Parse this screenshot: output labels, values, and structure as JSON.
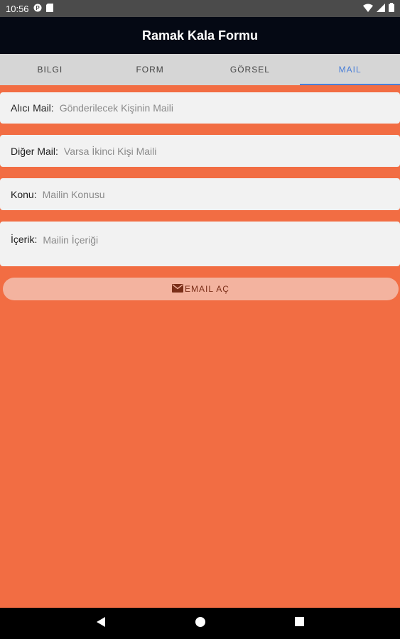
{
  "status_bar": {
    "time": "10:56"
  },
  "app_bar": {
    "title": "Ramak Kala Formu"
  },
  "tabs": [
    {
      "label": "BILGI"
    },
    {
      "label": "FORM"
    },
    {
      "label": "GÖRSEL"
    },
    {
      "label": "MAIL"
    }
  ],
  "active_tab": "MAIL",
  "form": {
    "recipient": {
      "label": "Alıcı Mail:",
      "placeholder": "Gönderilecek Kişinin Maili"
    },
    "other": {
      "label": "Diğer Mail:",
      "placeholder": "Varsa İkinci Kişi Maili"
    },
    "subject": {
      "label": "Konu:",
      "placeholder": "Mailin Konusu"
    },
    "content": {
      "label": "İçerik:",
      "placeholder": "Mailin İçeriği"
    }
  },
  "email_button": {
    "label": "EMAIL AÇ",
    "icon": "mail-icon"
  },
  "colors": {
    "background": "#f26d43",
    "app_bar": "#050914",
    "tab_bar": "#d6d6d6",
    "accent": "#4a7fd8",
    "button": "#f3b39f"
  }
}
